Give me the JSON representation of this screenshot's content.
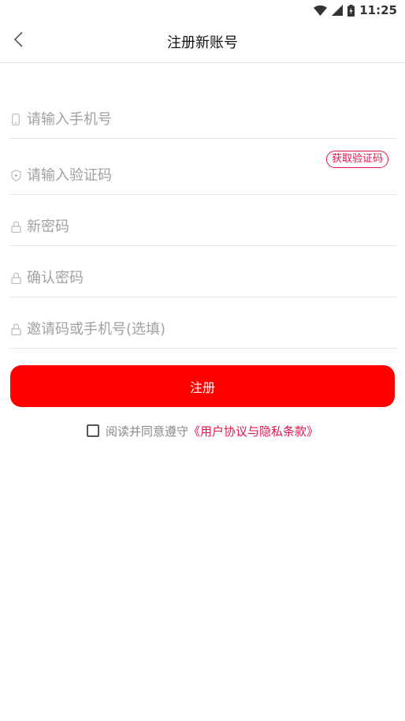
{
  "status_bar": {
    "time": "11:25",
    "icons": [
      "wifi-icon",
      "signal-icon",
      "battery-icon"
    ]
  },
  "nav": {
    "title": "注册新账号",
    "back_icon": "chevron-left-icon"
  },
  "form": {
    "phone": {
      "placeholder": "请输入手机号",
      "icon": "phone-icon"
    },
    "code": {
      "placeholder": "请输入验证码",
      "icon": "shield-icon",
      "button_label": "获取验证码"
    },
    "new_password": {
      "placeholder": "新密码",
      "icon": "lock-icon"
    },
    "confirm_password": {
      "placeholder": "确认密码",
      "icon": "lock-icon"
    },
    "invite": {
      "placeholder": "邀请码或手机号(选填)",
      "icon": "lock-icon"
    }
  },
  "submit": {
    "label": "注册"
  },
  "agreement": {
    "text": "阅读并同意遵守",
    "link": "《用户协议与隐私条款》",
    "checked": false
  },
  "colors": {
    "accent": "#ff0000",
    "link": "#e8134a",
    "placeholder": "#a0a0a0"
  }
}
